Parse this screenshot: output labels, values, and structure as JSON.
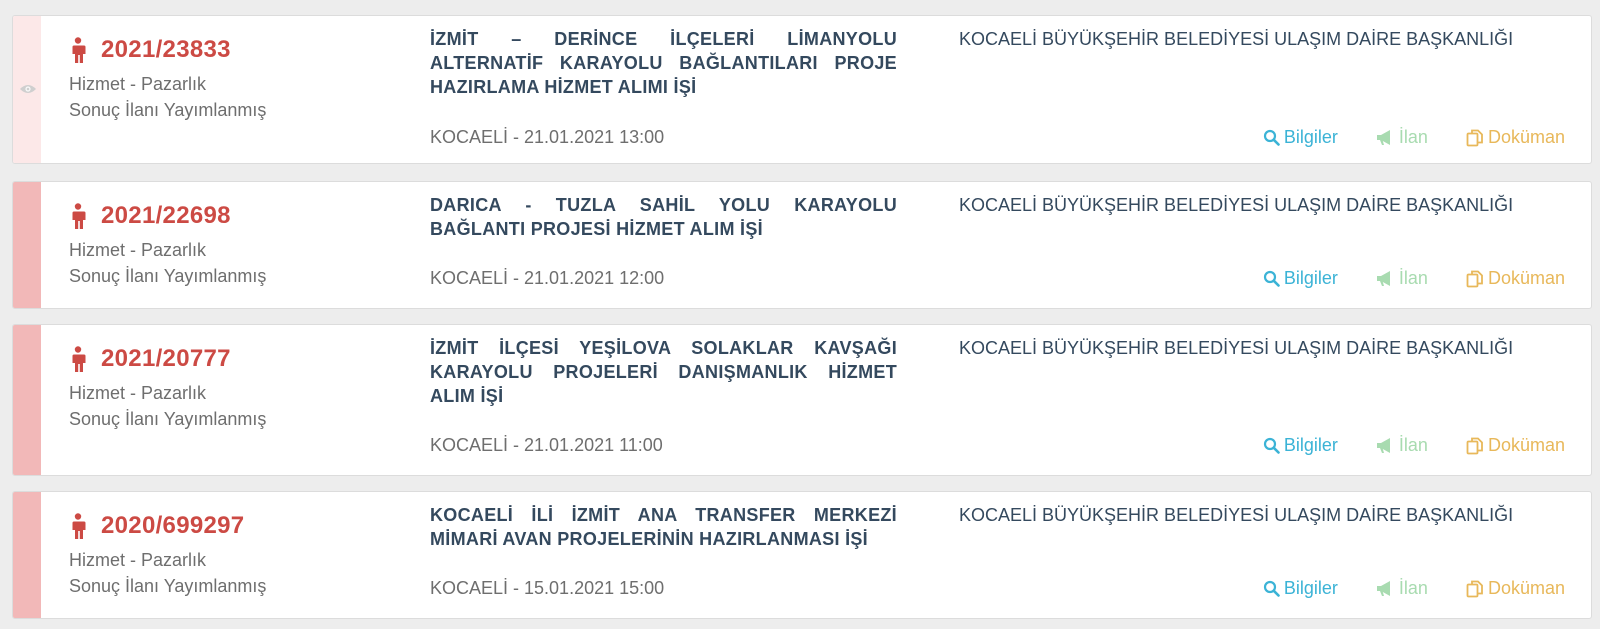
{
  "tenders": [
    {
      "id": "2021/23833",
      "type": "Hizmet - Pazarlık",
      "status": "Sonuç İlanı Yayımlanmış",
      "title": "İZMİT – DERİNCE İLÇELERİ LİMANYOLU ALTERNATİF KARAYOLU BAĞLANTILARI PROJE HAZIRLAMA HİZMET ALIMI İŞİ",
      "location": "KOCAELİ - 21.01.2021 13:00",
      "org": "KOCAELİ BÜYÜKŞEHİR BELEDİYESİ ULAŞIM DAİRE BAŞKANLIĞI"
    },
    {
      "id": "2021/22698",
      "type": "Hizmet - Pazarlık",
      "status": "Sonuç İlanı Yayımlanmış",
      "title": "DARICA - TUZLA SAHİL YOLU KARAYOLU BAĞLANTI PROJESİ HİZMET ALIM İŞİ",
      "location": "KOCAELİ - 21.01.2021 12:00",
      "org": "KOCAELİ BÜYÜKŞEHİR BELEDİYESİ ULAŞIM DAİRE BAŞKANLIĞI"
    },
    {
      "id": "2021/20777",
      "type": "Hizmet - Pazarlık",
      "status": "Sonuç İlanı Yayımlanmış",
      "title": "İZMİT İLÇESİ YEŞİLOVA SOLAKLAR KAVŞAĞI KARAYOLU PROJELERİ DANIŞMANLIK HİZMET ALIM İŞİ",
      "location": "KOCAELİ - 21.01.2021 11:00",
      "org": "KOCAELİ BÜYÜKŞEHİR BELEDİYESİ ULAŞIM DAİRE BAŞKANLIĞI"
    },
    {
      "id": "2020/699297",
      "type": "Hizmet - Pazarlık",
      "status": "Sonuç İlanı Yayımlanmış",
      "title": "KOCAELİ İLİ İZMİT ANA TRANSFER MERKEZİ MİMARİ AVAN PROJELERİNİN HAZIRLANMASI İŞİ",
      "location": "KOCAELİ - 15.01.2021 15:00",
      "org": "KOCAELİ BÜYÜKŞEHİR BELEDİYESİ ULAŞIM DAİRE BAŞKANLIĞI"
    }
  ],
  "actions": {
    "info_label": "Bilgiler",
    "ilan_label": "İlan",
    "doc_label": "Doküman"
  },
  "icons": {
    "tender": "person-icon",
    "viewed": "eye-icon",
    "info": "search-icon",
    "ilan": "megaphone-icon",
    "doc": "copy-icon"
  },
  "colors": {
    "id": "#cc4a44",
    "stripe": "#f2b8b8",
    "stripe_viewed": "#fce8e8",
    "info": "#3bb3d6",
    "ilan": "#a8dbb0",
    "doc": "#e8b85a",
    "title": "#34495e"
  }
}
